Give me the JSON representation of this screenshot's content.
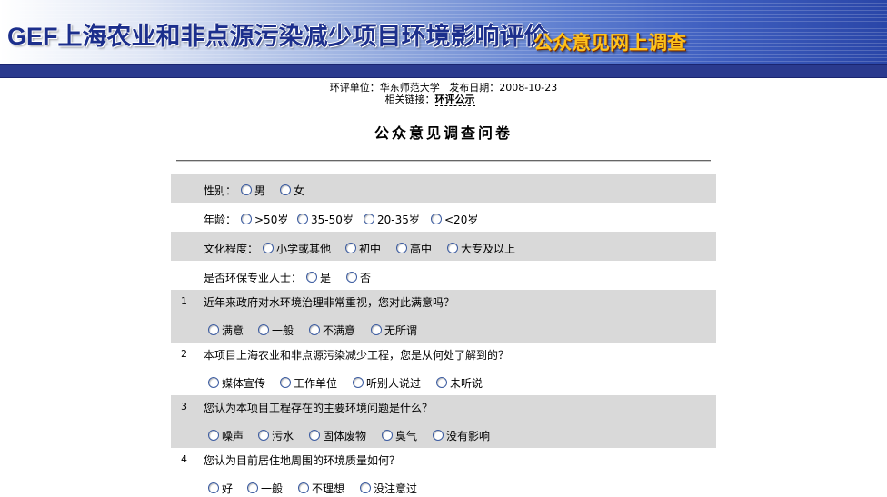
{
  "header": {
    "title": "GEF上海农业和非点源污染减少项目环境影响评价",
    "subtitle": "公众意见网上调查"
  },
  "info": {
    "unit_label": "环评单位：",
    "unit_value": "华东师范大学",
    "date_label": "发布日期：",
    "date_value": "2008-10-23",
    "link_label": "相关链接：",
    "link_text": "环评公示"
  },
  "form_title": "公众意见调查问卷",
  "questions": [
    {
      "label": "性别：",
      "options": [
        "男",
        "女"
      ]
    },
    {
      "label": "年龄：",
      "options": [
        ">50岁",
        "35-50岁",
        "20-35岁",
        "<20岁"
      ]
    },
    {
      "label": "文化程度：",
      "options": [
        "小学或其他",
        "初中",
        "高中",
        "大专及以上"
      ]
    },
    {
      "label": "是否环保专业人士：",
      "options": [
        "是",
        "否"
      ]
    },
    {
      "number": "1",
      "text": "近年来政府对水环境治理非常重视，您对此满意吗？",
      "options": [
        "满意",
        "一般",
        "不满意",
        "无所谓"
      ]
    },
    {
      "number": "2",
      "text": "本项目上海农业和非点源污染减少工程，您是从何处了解到的？",
      "options": [
        "媒体宣传",
        "工作单位",
        "听别人说过",
        "未听说"
      ]
    },
    {
      "number": "3",
      "text": "您认为本项目工程存在的主要环境问题是什么？",
      "options": [
        "噪声",
        "污水",
        "固体废物",
        "臭气",
        "没有影响"
      ]
    },
    {
      "number": "4",
      "text": "您认为目前居住地周围的环境质量如何？",
      "options": [
        "好",
        "一般",
        "不理想",
        "没注意过"
      ]
    }
  ]
}
